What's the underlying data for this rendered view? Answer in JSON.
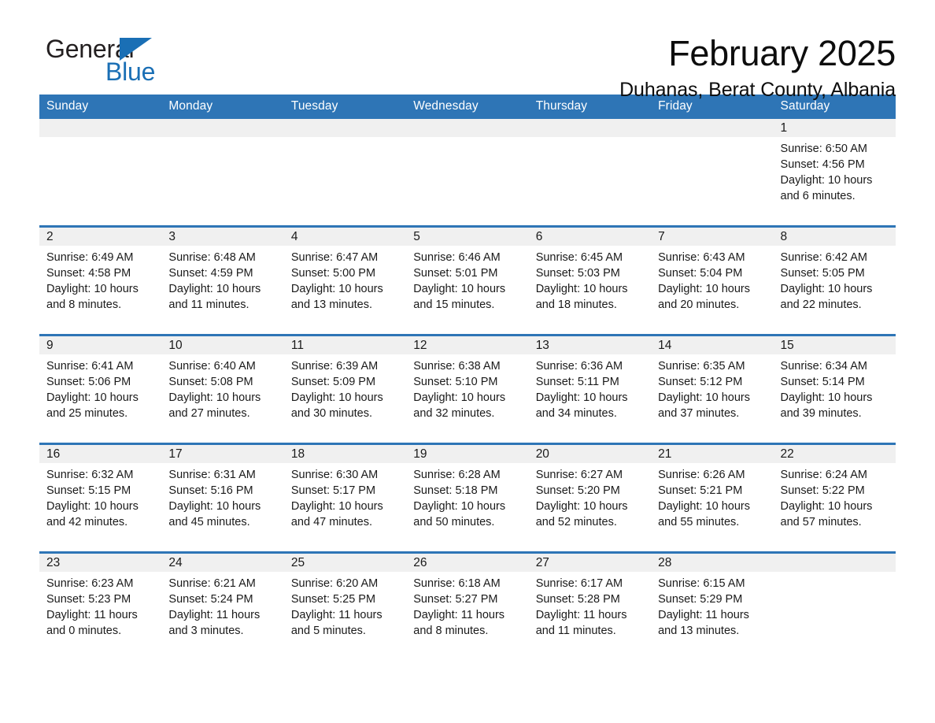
{
  "brand": {
    "word1": "General",
    "word2": "Blue",
    "accent_color": "#1a6fb5"
  },
  "header": {
    "month_title": "February 2025",
    "location": "Duhanas, Berat County, Albania"
  },
  "calendar": {
    "header_color": "#2e75b6",
    "daynum_band_color": "#f0f0f0",
    "columns": [
      "Sunday",
      "Monday",
      "Tuesday",
      "Wednesday",
      "Thursday",
      "Friday",
      "Saturday"
    ],
    "weeks": [
      [
        {
          "day": "",
          "sunrise": "",
          "sunset": "",
          "daylight": ""
        },
        {
          "day": "",
          "sunrise": "",
          "sunset": "",
          "daylight": ""
        },
        {
          "day": "",
          "sunrise": "",
          "sunset": "",
          "daylight": ""
        },
        {
          "day": "",
          "sunrise": "",
          "sunset": "",
          "daylight": ""
        },
        {
          "day": "",
          "sunrise": "",
          "sunset": "",
          "daylight": ""
        },
        {
          "day": "",
          "sunrise": "",
          "sunset": "",
          "daylight": ""
        },
        {
          "day": "1",
          "sunrise": "Sunrise: 6:50 AM",
          "sunset": "Sunset: 4:56 PM",
          "daylight": "Daylight: 10 hours and 6 minutes."
        }
      ],
      [
        {
          "day": "2",
          "sunrise": "Sunrise: 6:49 AM",
          "sunset": "Sunset: 4:58 PM",
          "daylight": "Daylight: 10 hours and 8 minutes."
        },
        {
          "day": "3",
          "sunrise": "Sunrise: 6:48 AM",
          "sunset": "Sunset: 4:59 PM",
          "daylight": "Daylight: 10 hours and 11 minutes."
        },
        {
          "day": "4",
          "sunrise": "Sunrise: 6:47 AM",
          "sunset": "Sunset: 5:00 PM",
          "daylight": "Daylight: 10 hours and 13 minutes."
        },
        {
          "day": "5",
          "sunrise": "Sunrise: 6:46 AM",
          "sunset": "Sunset: 5:01 PM",
          "daylight": "Daylight: 10 hours and 15 minutes."
        },
        {
          "day": "6",
          "sunrise": "Sunrise: 6:45 AM",
          "sunset": "Sunset: 5:03 PM",
          "daylight": "Daylight: 10 hours and 18 minutes."
        },
        {
          "day": "7",
          "sunrise": "Sunrise: 6:43 AM",
          "sunset": "Sunset: 5:04 PM",
          "daylight": "Daylight: 10 hours and 20 minutes."
        },
        {
          "day": "8",
          "sunrise": "Sunrise: 6:42 AM",
          "sunset": "Sunset: 5:05 PM",
          "daylight": "Daylight: 10 hours and 22 minutes."
        }
      ],
      [
        {
          "day": "9",
          "sunrise": "Sunrise: 6:41 AM",
          "sunset": "Sunset: 5:06 PM",
          "daylight": "Daylight: 10 hours and 25 minutes."
        },
        {
          "day": "10",
          "sunrise": "Sunrise: 6:40 AM",
          "sunset": "Sunset: 5:08 PM",
          "daylight": "Daylight: 10 hours and 27 minutes."
        },
        {
          "day": "11",
          "sunrise": "Sunrise: 6:39 AM",
          "sunset": "Sunset: 5:09 PM",
          "daylight": "Daylight: 10 hours and 30 minutes."
        },
        {
          "day": "12",
          "sunrise": "Sunrise: 6:38 AM",
          "sunset": "Sunset: 5:10 PM",
          "daylight": "Daylight: 10 hours and 32 minutes."
        },
        {
          "day": "13",
          "sunrise": "Sunrise: 6:36 AM",
          "sunset": "Sunset: 5:11 PM",
          "daylight": "Daylight: 10 hours and 34 minutes."
        },
        {
          "day": "14",
          "sunrise": "Sunrise: 6:35 AM",
          "sunset": "Sunset: 5:12 PM",
          "daylight": "Daylight: 10 hours and 37 minutes."
        },
        {
          "day": "15",
          "sunrise": "Sunrise: 6:34 AM",
          "sunset": "Sunset: 5:14 PM",
          "daylight": "Daylight: 10 hours and 39 minutes."
        }
      ],
      [
        {
          "day": "16",
          "sunrise": "Sunrise: 6:32 AM",
          "sunset": "Sunset: 5:15 PM",
          "daylight": "Daylight: 10 hours and 42 minutes."
        },
        {
          "day": "17",
          "sunrise": "Sunrise: 6:31 AM",
          "sunset": "Sunset: 5:16 PM",
          "daylight": "Daylight: 10 hours and 45 minutes."
        },
        {
          "day": "18",
          "sunrise": "Sunrise: 6:30 AM",
          "sunset": "Sunset: 5:17 PM",
          "daylight": "Daylight: 10 hours and 47 minutes."
        },
        {
          "day": "19",
          "sunrise": "Sunrise: 6:28 AM",
          "sunset": "Sunset: 5:18 PM",
          "daylight": "Daylight: 10 hours and 50 minutes."
        },
        {
          "day": "20",
          "sunrise": "Sunrise: 6:27 AM",
          "sunset": "Sunset: 5:20 PM",
          "daylight": "Daylight: 10 hours and 52 minutes."
        },
        {
          "day": "21",
          "sunrise": "Sunrise: 6:26 AM",
          "sunset": "Sunset: 5:21 PM",
          "daylight": "Daylight: 10 hours and 55 minutes."
        },
        {
          "day": "22",
          "sunrise": "Sunrise: 6:24 AM",
          "sunset": "Sunset: 5:22 PM",
          "daylight": "Daylight: 10 hours and 57 minutes."
        }
      ],
      [
        {
          "day": "23",
          "sunrise": "Sunrise: 6:23 AM",
          "sunset": "Sunset: 5:23 PM",
          "daylight": "Daylight: 11 hours and 0 minutes."
        },
        {
          "day": "24",
          "sunrise": "Sunrise: 6:21 AM",
          "sunset": "Sunset: 5:24 PM",
          "daylight": "Daylight: 11 hours and 3 minutes."
        },
        {
          "day": "25",
          "sunrise": "Sunrise: 6:20 AM",
          "sunset": "Sunset: 5:25 PM",
          "daylight": "Daylight: 11 hours and 5 minutes."
        },
        {
          "day": "26",
          "sunrise": "Sunrise: 6:18 AM",
          "sunset": "Sunset: 5:27 PM",
          "daylight": "Daylight: 11 hours and 8 minutes."
        },
        {
          "day": "27",
          "sunrise": "Sunrise: 6:17 AM",
          "sunset": "Sunset: 5:28 PM",
          "daylight": "Daylight: 11 hours and 11 minutes."
        },
        {
          "day": "28",
          "sunrise": "Sunrise: 6:15 AM",
          "sunset": "Sunset: 5:29 PM",
          "daylight": "Daylight: 11 hours and 13 minutes."
        },
        {
          "day": "",
          "sunrise": "",
          "sunset": "",
          "daylight": ""
        }
      ]
    ]
  }
}
